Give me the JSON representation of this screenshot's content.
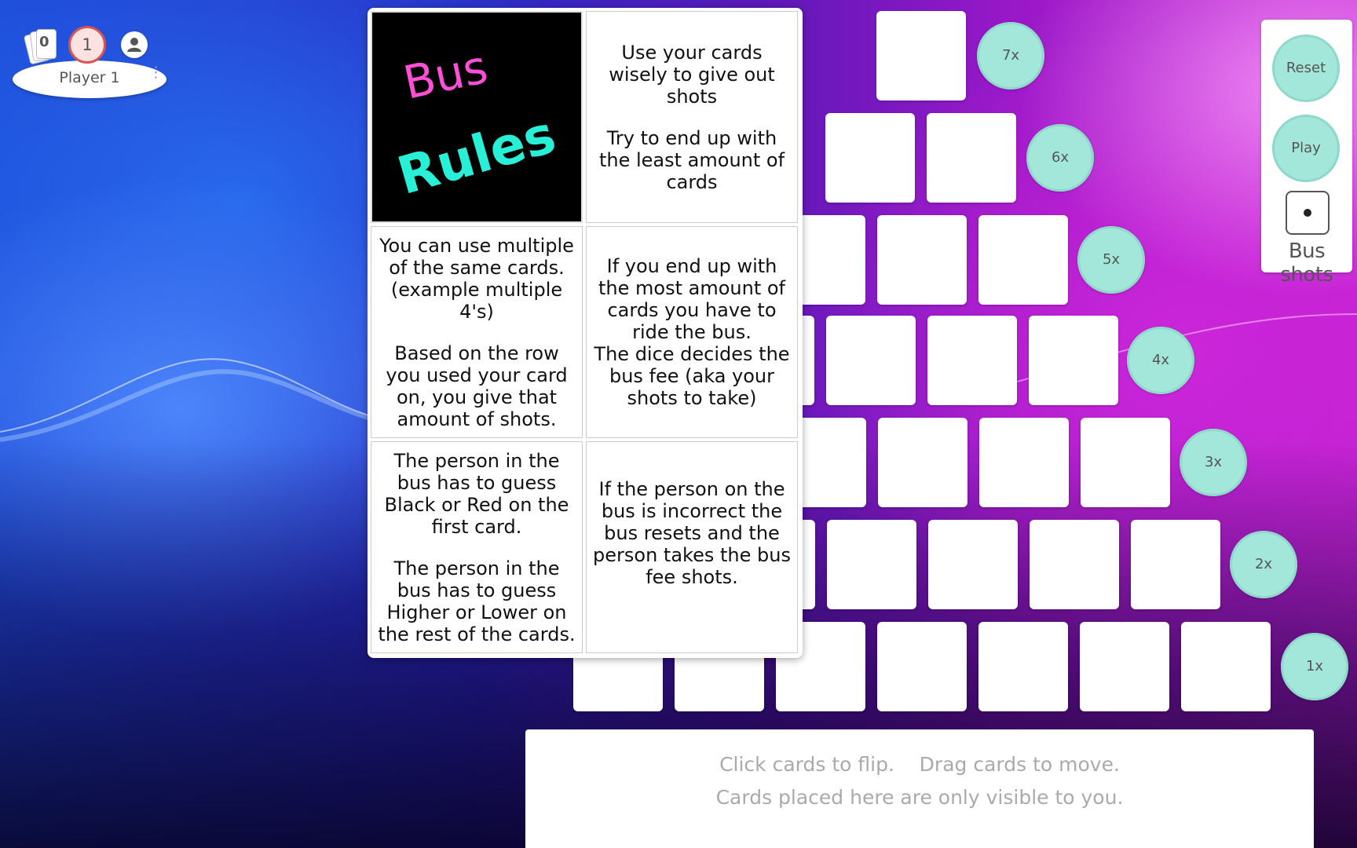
{
  "player": {
    "cards_count": "0",
    "score": "1",
    "name": "Player 1",
    "menu": "⋮"
  },
  "rules": {
    "logo_text_1": "Bus",
    "logo_text_2": "Rules",
    "cell_1": [
      "Use your cards wisely to give out shots",
      "Try to end up with the least amount of cards"
    ],
    "cell_2": [
      "You can use multiple of the same cards. (example multiple 4's)",
      "Based on the row you used your card on, you give that amount of shots."
    ],
    "cell_3": [
      "If you end up with the most amount of cards you have to ride the bus.",
      "The dice decides the bus fee (aka your shots to take)"
    ],
    "cell_4": [
      "The person in the bus has to guess Black or Red on the first card.",
      "The person in the bus has to guess Higher or Lower on the rest of the cards."
    ],
    "cell_5": [
      "If the person on the bus is incorrect the bus resets and the person takes the bus fee shots."
    ]
  },
  "multipliers": [
    "7x",
    "6x",
    "5x",
    "4x",
    "3x",
    "2x",
    "1x"
  ],
  "pyramid_rows": [
    1,
    2,
    3,
    4,
    5,
    6,
    7
  ],
  "controls": {
    "reset_label": "Reset",
    "play_label": "Play",
    "bus_shots_label": "Bus shots",
    "dice_value": 1
  },
  "hand": {
    "line1": "Click cards to flip.    Drag cards to move.",
    "line2": "Cards placed here are only visible to you."
  },
  "colors": {
    "multiplier": "#a3e6da",
    "logo_bus": "#ff4fd8",
    "logo_rules": "#27f0d6",
    "score_border": "#d9534f"
  }
}
